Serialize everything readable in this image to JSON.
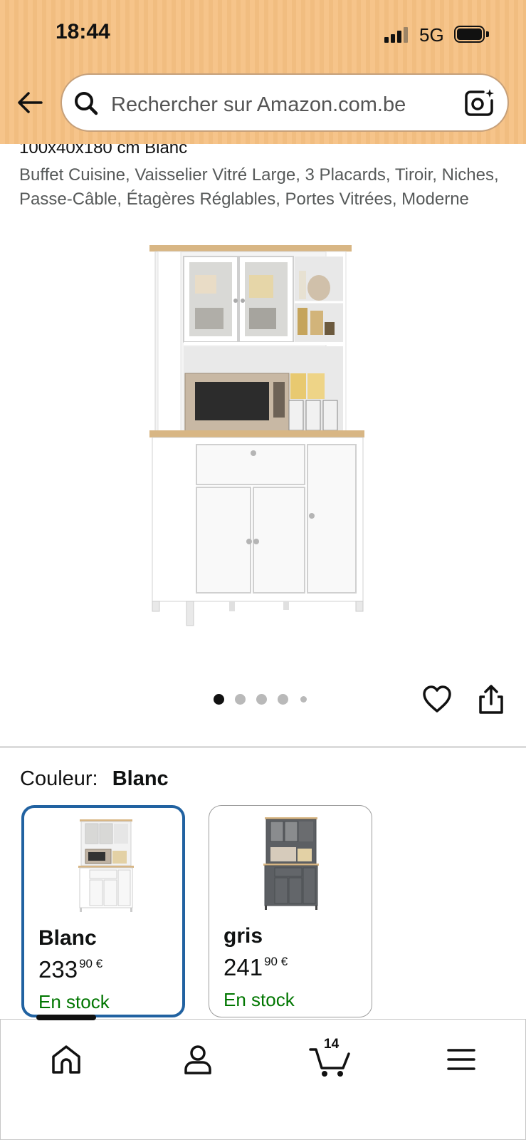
{
  "status_bar": {
    "time": "18:44",
    "network": "5G"
  },
  "search": {
    "placeholder": "Rechercher sur Amazon.com.be"
  },
  "product": {
    "title_visible_part": "100x40x180 cm Blanc",
    "subtitle": "Buffet Cuisine, Vaisselier Vitré Large, 3 Placards, Tiroir, Niches, Passe-Câble, Étagères Réglables, Portes Vitrées, Moderne",
    "image_count": 5,
    "active_image": 1
  },
  "color_selection": {
    "label": "Couleur:",
    "selected": "Blanc",
    "options": [
      {
        "name": "Blanc",
        "price_whole": "233",
        "price_fraction": "90 €",
        "availability": "En stock",
        "selected": true
      },
      {
        "name": "gris",
        "price_whole": "241",
        "price_fraction": "90 €",
        "availability": "En stock",
        "selected": false
      }
    ]
  },
  "bottom_nav": {
    "items": [
      "home-icon",
      "account-icon",
      "cart-icon",
      "menu-icon"
    ],
    "cart_count": "14"
  },
  "colors": {
    "header_bg": "#f6c48a",
    "selected_border": "#2162a1",
    "stock_green": "#007600",
    "text": "#0f1111",
    "secondary_text": "#565959"
  }
}
